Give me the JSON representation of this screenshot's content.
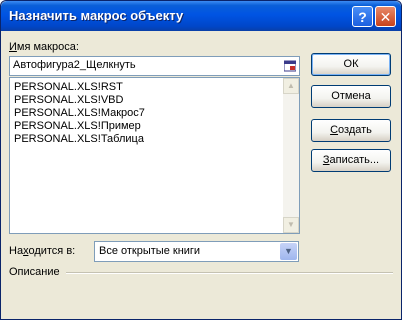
{
  "window": {
    "title": "Назначить макрос объекту",
    "help_glyph": "?",
    "close_glyph": "✕"
  },
  "macro_name": {
    "label_prefix": "",
    "label_hotkey": "И",
    "label_rest": "мя макроса:",
    "value": "Автофигура2_Щелкнуть"
  },
  "macro_list": {
    "items": [
      "PERSONAL.XLS!RST",
      "PERSONAL.XLS!VBD",
      "PERSONAL.XLS!Макрос7",
      "PERSONAL.XLS!Пример",
      "PERSONAL.XLS!Таблица"
    ],
    "scroll_up_glyph": "▲",
    "scroll_down_glyph": "▼"
  },
  "buttons": {
    "ok": "ОК",
    "cancel": "Отмена",
    "create_hotkey": "С",
    "create_rest": "оздать",
    "record_hotkey": "З",
    "record_rest": "аписать..."
  },
  "location": {
    "label_prefix": "На",
    "label_hotkey": "х",
    "label_rest": "одится в:",
    "selected": "Все открытые книги",
    "arrow_glyph": "▼"
  },
  "description": {
    "label": "Описание"
  },
  "colors": {
    "titlebar": "#0054e3",
    "dialog_bg": "#ece9d8",
    "field_border": "#7f9db9"
  }
}
